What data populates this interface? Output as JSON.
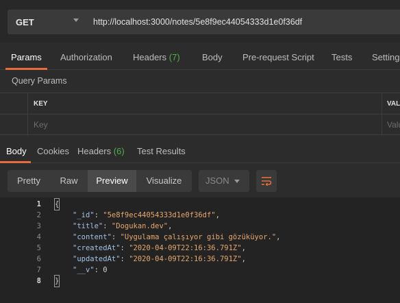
{
  "request": {
    "method": "GET",
    "url": "http://localhost:3000/notes/5e8f9ec44054333d1e0f36df"
  },
  "request_tabs": [
    {
      "label": "Params",
      "count": ""
    },
    {
      "label": "Authorization",
      "count": ""
    },
    {
      "label": "Headers",
      "count": "(7)"
    },
    {
      "label": "Body",
      "count": ""
    },
    {
      "label": "Pre-request Script",
      "count": ""
    },
    {
      "label": "Tests",
      "count": ""
    },
    {
      "label": "Settings",
      "count": ""
    }
  ],
  "query_params": {
    "title": "Query Params",
    "key_header": "KEY",
    "value_header": "VALUE",
    "key_placeholder": "Key",
    "value_placeholder": "Value"
  },
  "response_tabs": [
    {
      "label": "Body",
      "count": ""
    },
    {
      "label": "Cookies",
      "count": ""
    },
    {
      "label": "Headers",
      "count": "(6)"
    },
    {
      "label": "Test Results",
      "count": ""
    }
  ],
  "view_modes": [
    "Pretty",
    "Raw",
    "Preview",
    "Visualize"
  ],
  "active_view": "Preview",
  "format": "JSON",
  "icons": {
    "method_dropdown": "chevron-down-icon",
    "format_dropdown": "chevron-down-icon",
    "wrap": "wrap-lines-icon"
  },
  "colors": {
    "accent": "#e86c3c",
    "count": "#4fb04f",
    "json_key": "#9fc3e8",
    "json_string": "#e8a76c"
  },
  "code": {
    "line_numbers": [
      "1",
      "2",
      "3",
      "4",
      "5",
      "6",
      "7",
      "8"
    ],
    "open_brace": "{",
    "close_brace": "}",
    "fields": [
      {
        "key": "\"_id\"",
        "value": "\"5e8f9ec44054333d1e0f36df\"",
        "type": "string"
      },
      {
        "key": "\"title\"",
        "value": "\"Dogukan.dev\"",
        "type": "string"
      },
      {
        "key": "\"content\"",
        "value": "\"Uygulama çalışıyor gibi gözüküyor.\"",
        "type": "string"
      },
      {
        "key": "\"createdAt\"",
        "value": "\"2020-04-09T22:16:36.791Z\"",
        "type": "string"
      },
      {
        "key": "\"updatedAt\"",
        "value": "\"2020-04-09T22:16:36.791Z\"",
        "type": "string"
      },
      {
        "key": "\"__v\"",
        "value": "0",
        "type": "number"
      }
    ]
  }
}
